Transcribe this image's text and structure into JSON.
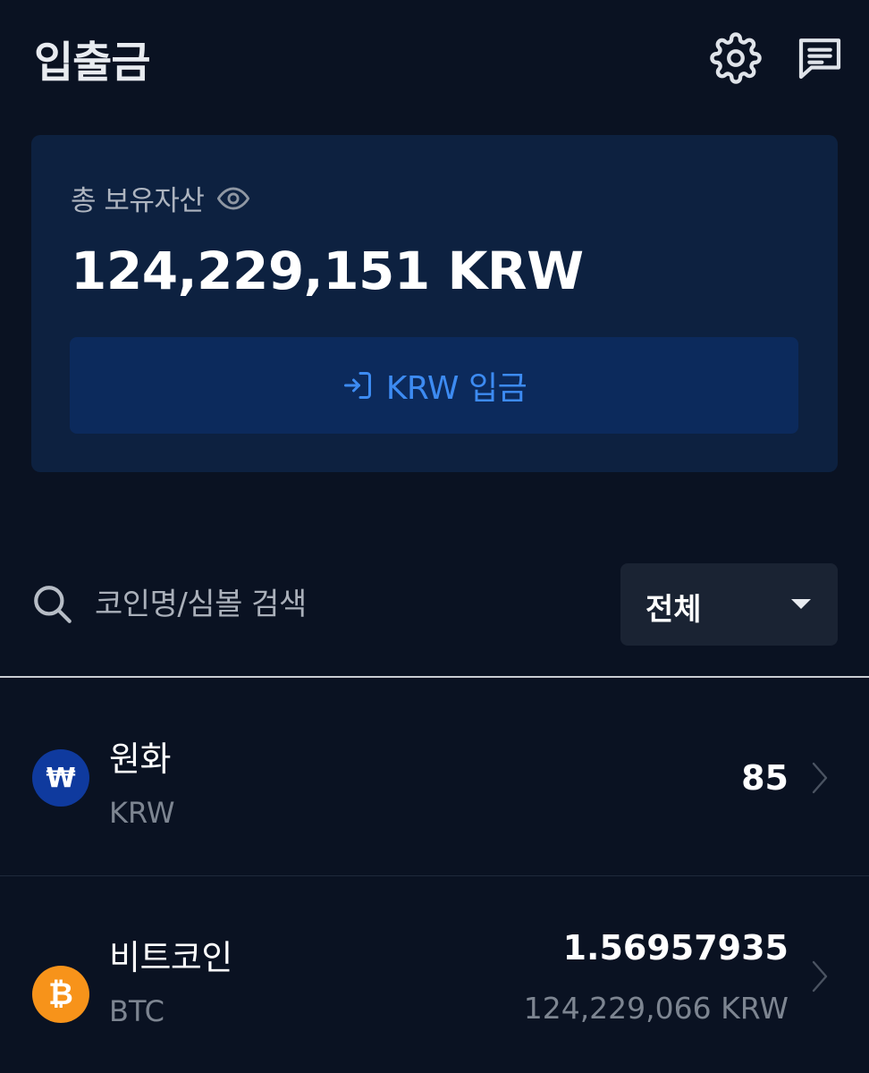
{
  "header": {
    "title": "입출금",
    "settings_icon": "gear-icon",
    "chat_icon": "chat-icon"
  },
  "summary": {
    "label": "총 보유자산",
    "eye_icon": "eye-icon",
    "total": "124,229,151 KRW",
    "deposit_label": "KRW 입금",
    "deposit_icon": "login-arrow-icon"
  },
  "search": {
    "placeholder": "코인명/심볼 검색"
  },
  "filter": {
    "selected": "전체"
  },
  "assets": [
    {
      "name": "원화",
      "symbol": "KRW",
      "icon_glyph": "₩",
      "icon_color": "#0f3a9e",
      "amount": "85",
      "value": ""
    },
    {
      "name": "비트코인",
      "symbol": "BTC",
      "icon_glyph": "₿",
      "icon_color": "#f7931a",
      "amount": "1.56957935",
      "value": "124,229,066 KRW"
    }
  ],
  "colors": {
    "background": "#0a1222",
    "card": "#0d2140",
    "accent": "#3d8bf2"
  }
}
